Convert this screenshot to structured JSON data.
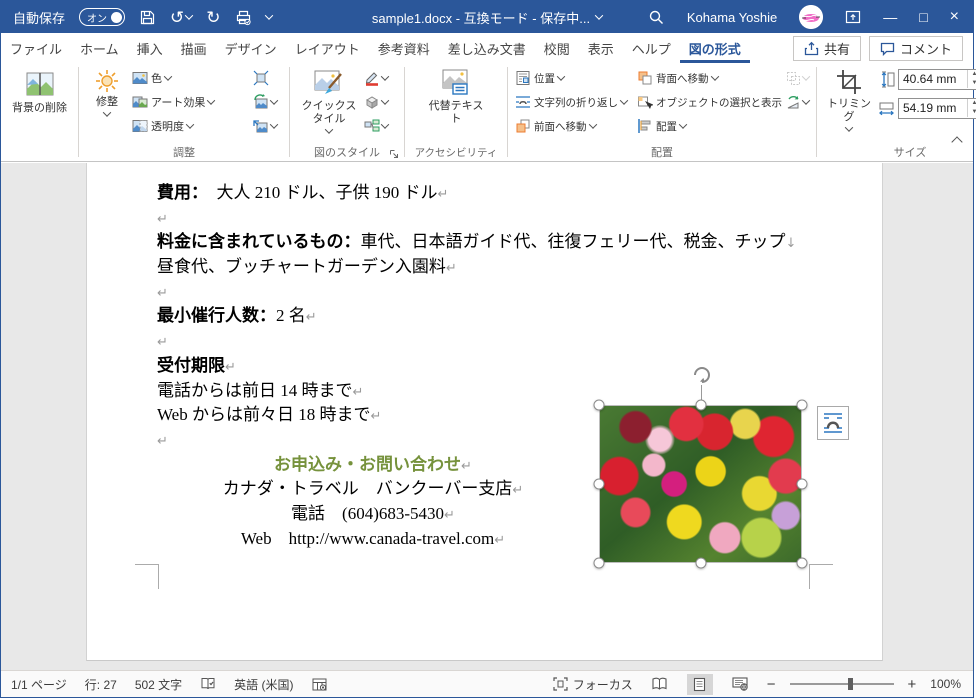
{
  "titlebar": {
    "autosave_label": "自動保存",
    "autosave_state": "オン",
    "title": "sample1.docx - 互換モード - 保存中...",
    "user_name": "Kohama Yoshie"
  },
  "tabs": {
    "items": [
      "ファイル",
      "ホーム",
      "挿入",
      "描画",
      "デザイン",
      "レイアウト",
      "参考資料",
      "差し込み文書",
      "校閲",
      "表示",
      "ヘルプ",
      "図の形式"
    ],
    "active": "図の形式",
    "share_label": "共有",
    "comments_label": "コメント"
  },
  "ribbon": {
    "remove_bg_label": "背景の削除",
    "adjust": {
      "corrections": "修整",
      "color": "色",
      "artistic_effects": "アート効果",
      "transparency": "透明度",
      "group_label": "調整"
    },
    "picture_styles": {
      "quick_styles": "クイックスタイル",
      "group_label": "図のスタイル"
    },
    "accessibility": {
      "alt_text": "代替テキスト",
      "group_label": "アクセシビリティ"
    },
    "arrange": {
      "position": "位置",
      "wrap_text": "文字列の折り返し",
      "bring_forward": "前面へ移動",
      "send_backward": "背面へ移動",
      "selection_pane": "オブジェクトの選択と表示",
      "align": "配置",
      "group_label": "配置"
    },
    "size": {
      "crop": "トリミング",
      "height_value": "40.64 mm",
      "width_value": "54.19 mm",
      "group_label": "サイズ"
    }
  },
  "doc": {
    "lines": [
      {
        "bold": "費用：",
        "text": "　大人 210 ドル、子供 190 ドル",
        "mark": "↵"
      },
      {
        "bold": "",
        "text": "",
        "mark": "↵"
      },
      {
        "bold": "料金に含まれているもの：",
        "text": "車代、日本語ガイド代、往復フェリー代、税金、チップ",
        "mark": "↓"
      },
      {
        "bold": "",
        "text": "昼食代、ブッチャートガーデン入園料",
        "mark": "↵"
      },
      {
        "bold": "",
        "text": "",
        "mark": "↵"
      },
      {
        "bold": "最小催行人数：",
        "text": "2 名",
        "mark": "↵"
      },
      {
        "bold": "",
        "text": "",
        "mark": "↵"
      },
      {
        "bold": "受付期限",
        "text": "",
        "mark": "↵"
      },
      {
        "bold": "",
        "text": "電話からは前日 14 時まで",
        "mark": "↵"
      },
      {
        "bold": "",
        "text": "Web からは前々日 18 時まで",
        "mark": "↵"
      },
      {
        "bold": "",
        "text": "",
        "mark": "↵"
      }
    ],
    "centered": [
      {
        "text": "お申込み・お問い合わせ",
        "mark": "↵"
      },
      {
        "text": "カナダ・トラベル　バンクーバー支店",
        "mark": "↵"
      },
      {
        "text": "電話　(604)683-5430",
        "mark": "↵"
      },
      {
        "text": "Web　http://www.canada-travel.com",
        "mark": "↵"
      }
    ],
    "heading_color": "#76923C",
    "image_name": "flower-basket-photo"
  },
  "statusbar": {
    "page": "1/1 ページ",
    "line": "行: 27",
    "chars": "502 文字",
    "language": "英語 (米国)",
    "focus": "フォーカス",
    "zoom": "100%",
    "zoom_minus": "−",
    "zoom_plus": "+"
  },
  "colors": {
    "titlebar_blue": "#2b579a",
    "accent_orange": "#ed7d31",
    "canvas_gray": "#e8e8e8"
  }
}
